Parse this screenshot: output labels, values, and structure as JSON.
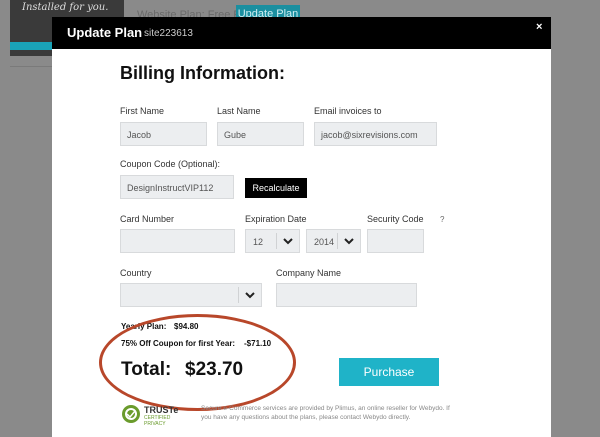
{
  "background": {
    "thumb_text": "Installed for you.",
    "plan_text": "Website Plan: Free Plan",
    "update_button": "Update Plan"
  },
  "modal": {
    "title": "Update Plan",
    "site_id": "site223613",
    "close": "×"
  },
  "billing": {
    "heading": "Billing Information:",
    "first_name": {
      "label": "First Name",
      "value": "Jacob"
    },
    "last_name": {
      "label": "Last Name",
      "value": "Gube"
    },
    "email": {
      "label": "Email invoices to",
      "value": "jacob@sixrevisions.com"
    },
    "coupon": {
      "label": "Coupon Code (Optional):",
      "value": "DesignInstructVIP112",
      "button": "Recalculate"
    },
    "card_number": {
      "label": "Card Number",
      "value": ""
    },
    "expiration": {
      "label": "Expiration Date",
      "month": "12",
      "year": "2014"
    },
    "security_code": {
      "label": "Security Code",
      "help": "?",
      "value": ""
    },
    "country": {
      "label": "Country",
      "value": ""
    },
    "company": {
      "label": "Company Name",
      "value": ""
    }
  },
  "summary": {
    "yearly_plan_label": "Yearly Plan:",
    "yearly_plan_value": "$94.80",
    "coupon_label": "75% Off Coupon for first Year:",
    "coupon_value": "-$71.10",
    "total_label": "Total:",
    "total_value": "$23.70"
  },
  "purchase_button": "Purchase",
  "footer": {
    "truste_name": "TRUSTe",
    "truste_sub": "CERTIFIED PRIVACY",
    "note": "Secure e-Commerce services are provided by Plimus, an online reseller for Webydo. If you have any questions about the plans, please contact Webydo directly."
  },
  "colors": {
    "accent": "#1fb3c8",
    "annotation_circle": "#b8472a",
    "header": "#000000"
  }
}
